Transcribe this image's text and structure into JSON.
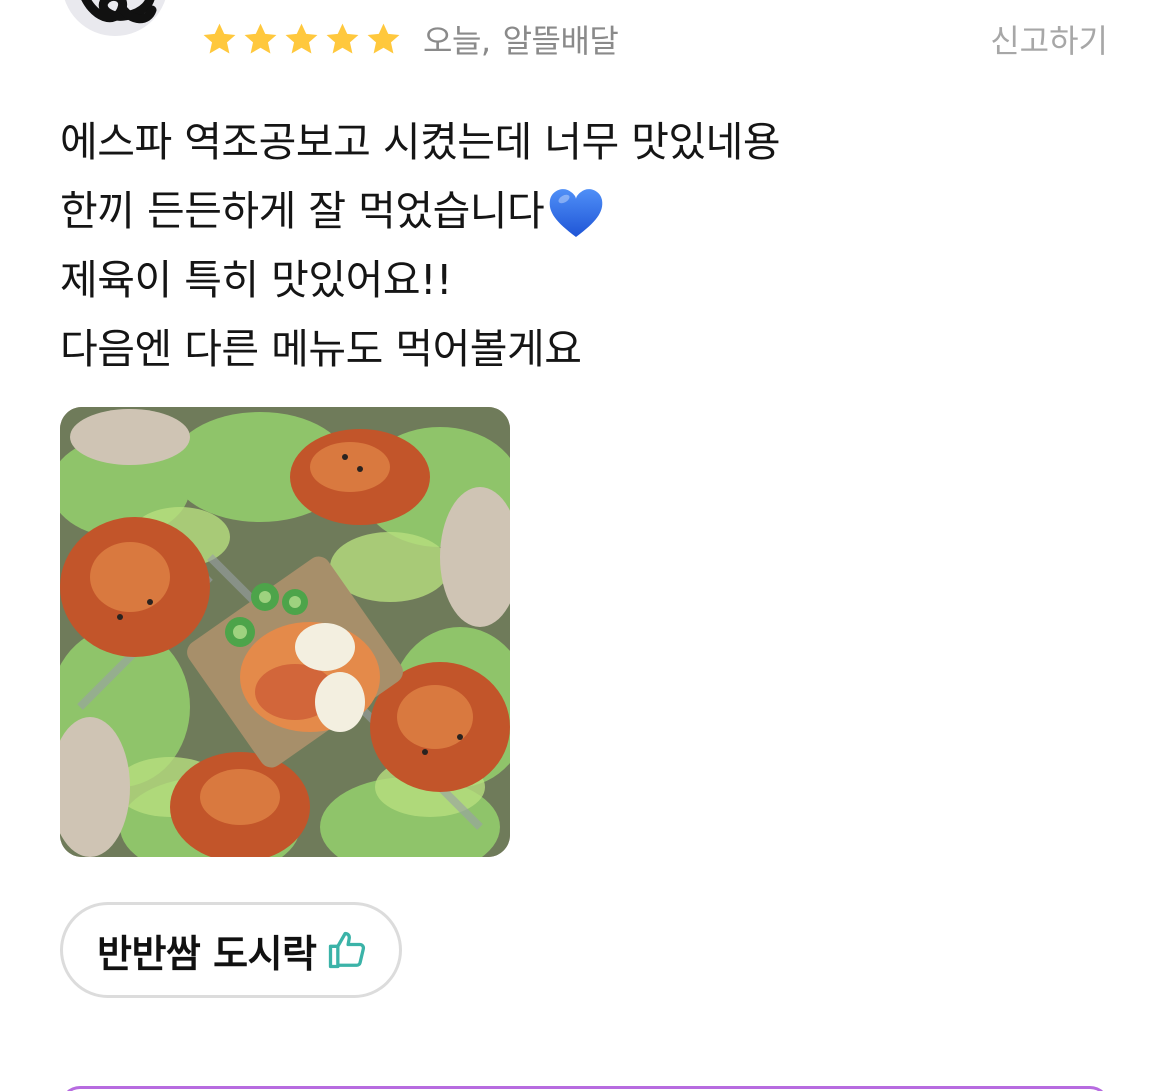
{
  "review": {
    "rating": 5,
    "rating_max": 5,
    "date": "오늘,",
    "delivery": "알뜰배달",
    "report_label": "신고하기",
    "lines": [
      "에스파 역조공보고 시켰는데 너무 맛있네용",
      "한끼 든든하게 잘 먹었습니다",
      "제육이 특히 맛있어요!!",
      "다음엔 다른 메뉴도 먹어볼게요"
    ],
    "menu_label": "반반쌈 도시락"
  },
  "icons": {
    "star": "star-icon",
    "heart": "blue-heart-icon",
    "thumb": "thumbs-up-icon"
  },
  "colors": {
    "star": "#ffc83d",
    "meta_text": "#8a8a8a",
    "report_text": "#a7a7a7",
    "heart": "#2f6fe8",
    "thumb": "#3bb3a8",
    "chip_border": "#dcdcdc"
  }
}
